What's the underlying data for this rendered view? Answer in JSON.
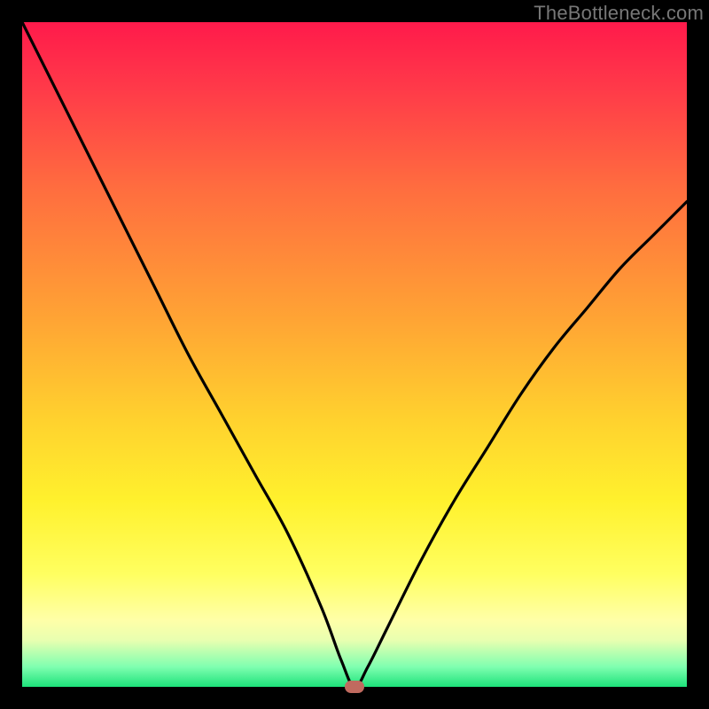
{
  "watermark": "TheBottleneck.com",
  "colors": {
    "frame": "#000000",
    "gradient_top": "#ff1a4b",
    "gradient_mid": "#ffd22e",
    "gradient_bottom": "#1de27a",
    "curve": "#000000",
    "marker": "#c06a5f"
  },
  "chart_data": {
    "type": "line",
    "title": "",
    "xlabel": "",
    "ylabel": "",
    "xlim": [
      0,
      100
    ],
    "ylim": [
      0,
      100
    ],
    "series": [
      {
        "name": "bottleneck-curve",
        "x": [
          0,
          5,
          10,
          15,
          20,
          25,
          30,
          35,
          40,
          45,
          48,
          50,
          52,
          55,
          60,
          65,
          70,
          75,
          80,
          85,
          90,
          95,
          100
        ],
        "y": [
          100,
          90,
          80,
          70,
          60,
          50,
          41,
          32,
          23,
          12,
          4,
          0,
          3,
          9,
          19,
          28,
          36,
          44,
          51,
          57,
          63,
          68,
          73
        ]
      }
    ],
    "annotations": [
      {
        "name": "optimal-marker",
        "x": 50,
        "y": 0
      }
    ],
    "grid": false,
    "legend": false
  }
}
